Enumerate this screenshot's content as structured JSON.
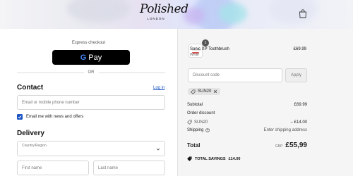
{
  "header": {
    "logo_script": "Polished",
    "logo_sub": "LONDON"
  },
  "checkout": {
    "express_label": "Express checkout",
    "gpay_g": "G",
    "gpay_pay": "Pay",
    "or_label": "OR"
  },
  "contact": {
    "title": "Contact",
    "login_link": "Log in",
    "email_placeholder": "Email or mobile phone number",
    "newsletter_label": "Email me with news and offers",
    "newsletter_checked": true
  },
  "delivery": {
    "title": "Delivery",
    "country_label": "Country/Region",
    "first_name_placeholder": "First name",
    "last_name_placeholder": "Last name"
  },
  "summary": {
    "product": {
      "quantity": "1",
      "name": "Sonic XP Toothbrush",
      "variant": "White",
      "price": "£69.99"
    },
    "discount_placeholder": "Discount code",
    "apply_label": "Apply",
    "applied_code": "SUN20",
    "subtotal_label": "Subtotal",
    "subtotal_value": "£69.99",
    "order_discount_label": "Order discount",
    "discount_code": "SUN20",
    "discount_value": "– £14.00",
    "shipping_label": "Shipping",
    "shipping_value": "Enter shipping address",
    "total_label": "Total",
    "total_currency": "GBP",
    "total_value": "£55,99",
    "savings_label": "TOTAL SAVINGS",
    "savings_value": "£14.00"
  },
  "colors": {
    "accent": "#1d55c4",
    "button_dark": "#000000",
    "summary_bg": "#f5f5f5"
  }
}
